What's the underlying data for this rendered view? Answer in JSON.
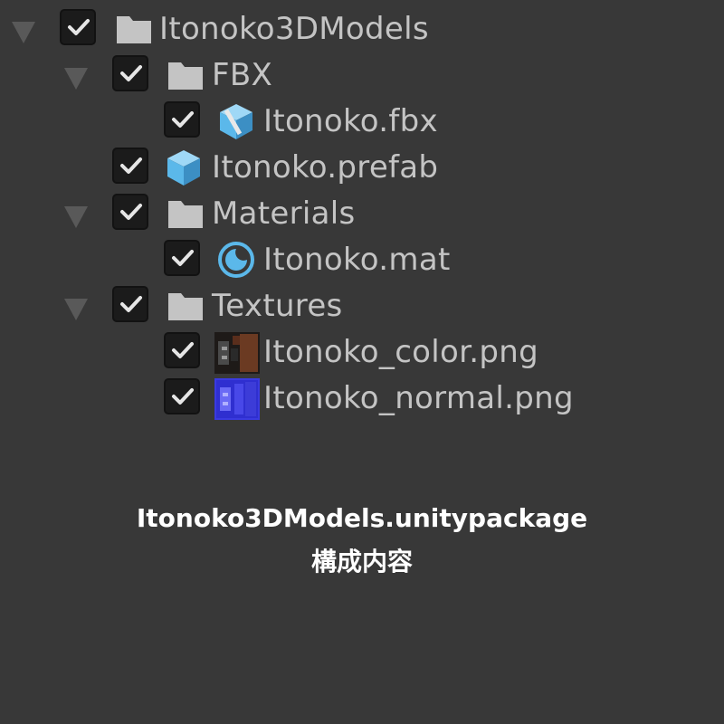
{
  "tree": {
    "items": [
      {
        "label": "Itonoko3DModels",
        "icon": "folder-icon",
        "checked": true,
        "expanded": true
      },
      {
        "label": "FBX",
        "icon": "folder-icon",
        "checked": true,
        "expanded": true
      },
      {
        "label": "Itonoko.fbx",
        "icon": "model-icon",
        "checked": true
      },
      {
        "label": "Itonoko.prefab",
        "icon": "prefab-icon",
        "checked": true
      },
      {
        "label": "Materials",
        "icon": "folder-icon",
        "checked": true,
        "expanded": true
      },
      {
        "label": "Itonoko.mat",
        "icon": "material-icon",
        "checked": true
      },
      {
        "label": "Textures",
        "icon": "folder-icon",
        "checked": true,
        "expanded": true
      },
      {
        "label": "Itonoko_color.png",
        "icon": "texture-color-icon",
        "checked": true
      },
      {
        "label": "Itonoko_normal.png",
        "icon": "texture-normal-icon",
        "checked": true
      }
    ]
  },
  "caption": {
    "line1": "Itonoko3DModels.unitypackage",
    "line2": "構成内容"
  },
  "colors": {
    "background": "#383838",
    "label": "#c4c4c4",
    "folder": "#c4c4c4",
    "prefab_blue": "#5bb8ea",
    "caption": "#ffffff"
  }
}
